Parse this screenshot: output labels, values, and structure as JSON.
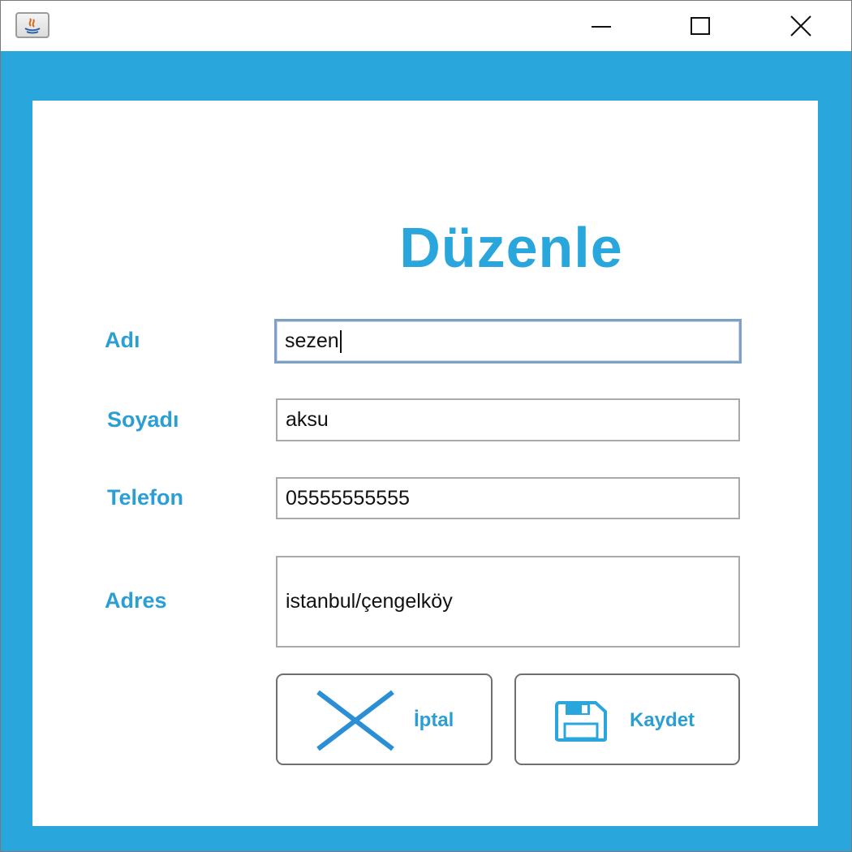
{
  "window": {
    "controls": {
      "minimize": "minimize-icon",
      "maximize": "maximize-icon",
      "close": "close-icon"
    }
  },
  "form": {
    "title": "Düzenle",
    "fields": {
      "name": {
        "label": "Adı",
        "value": "sezen"
      },
      "surname": {
        "label": "Soyadı",
        "value": "aksu"
      },
      "phone": {
        "label": "Telefon",
        "value": "05555555555"
      },
      "address": {
        "label": "Adres",
        "value": "istanbul/çengelköy"
      }
    },
    "buttons": {
      "cancel": {
        "label": "İptal",
        "icon": "close-x-icon"
      },
      "save": {
        "label": "Kaydet",
        "icon": "floppy-disk-icon"
      }
    }
  },
  "colors": {
    "accent": "#29a6dc",
    "label": "#2b9fd3",
    "field_border": "#a9a9a9",
    "focus_border": "#7ea0c4"
  }
}
